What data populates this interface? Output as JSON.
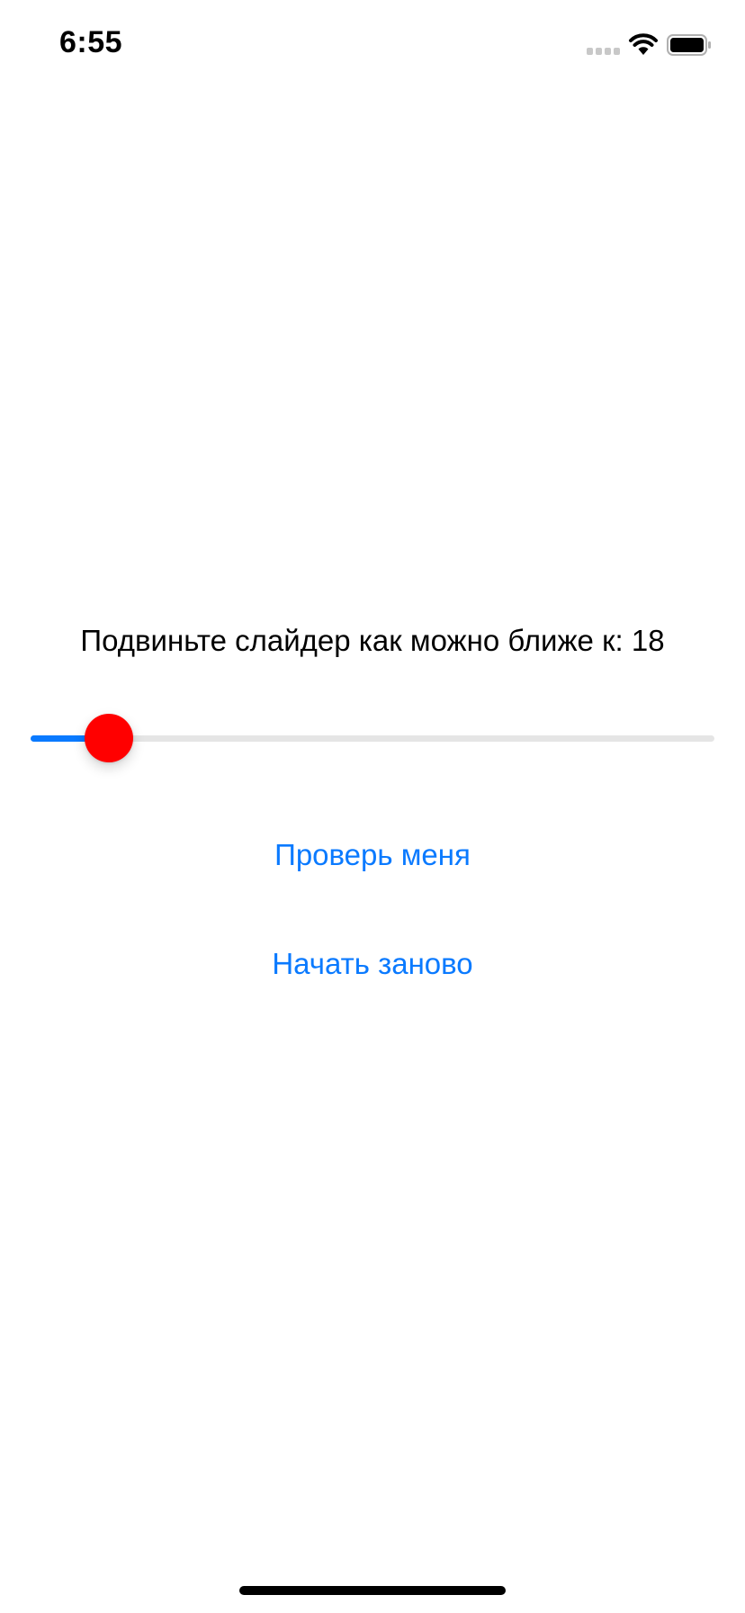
{
  "status_bar": {
    "time": "6:55",
    "icons": [
      "cellular-signal-icon",
      "wifi-icon",
      "battery-icon"
    ]
  },
  "game": {
    "prompt": "Подвиньте слайдер как можно ближе к: 18",
    "slider": {
      "min": 0,
      "max": 100,
      "value": 8.5,
      "thumb_color": "#ff0000",
      "fill_color": "#0a7aff",
      "track_color": "#e5e5e5"
    },
    "check_button_label": "Проверь меня",
    "restart_button_label": "Начать заново"
  },
  "colors": {
    "accent": "#0a7aff",
    "background": "#ffffff"
  }
}
